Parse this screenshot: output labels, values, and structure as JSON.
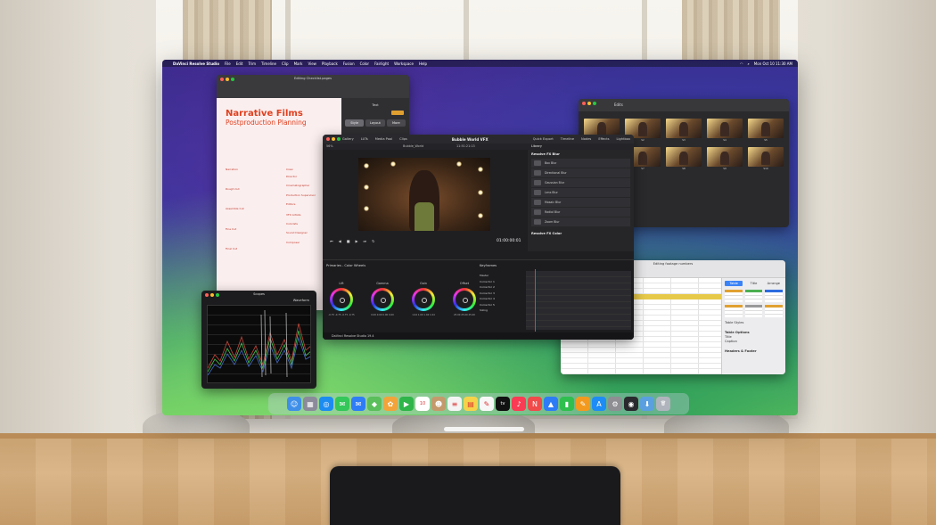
{
  "menubar": {
    "items": [
      "DaVinci Resolve Studio",
      "File",
      "Edit",
      "Trim",
      "Timeline",
      "Clip",
      "Mark",
      "View",
      "Playback",
      "Fusion",
      "Color",
      "Fairlight",
      "Workspace",
      "Help"
    ],
    "clock": "Mon Oct 10 11:30 AM"
  },
  "pages": {
    "window_title": "Editing Checklist.pages",
    "doc_title": "Narrative Films",
    "doc_subtitle": "Postproduction Planning",
    "left_col": [
      "Narration",
      "Rough Cut",
      "Assemble Cut",
      "Fine Cut",
      "Final Cut"
    ],
    "right_col": [
      "Crew",
      "Director",
      "Cinematographer",
      "Production Supervisor",
      "Editors",
      "VFX Artists",
      "Colorists",
      "Sound Designer",
      "Composer"
    ],
    "panel_label": "Text",
    "seg": [
      "Style",
      "Layout",
      "More"
    ]
  },
  "finder": {
    "title": "Edits",
    "files": [
      "S1",
      "S2",
      "S3",
      "S4",
      "S5",
      "S6",
      "S7",
      "S8",
      "S9",
      "S10"
    ]
  },
  "resolve": {
    "title": "Bubble World VFX",
    "project": "Bubble_World",
    "zoom": "56%",
    "timecode_top": "11:51:21:13",
    "timecode": "01:00:00:01",
    "tabs": [
      "Gallery",
      "LUTs",
      "Media Pool",
      "Clips"
    ],
    "right_tabs": [
      "Quick Export",
      "Timeline",
      "Nodes",
      "Effects",
      "Lightbox"
    ],
    "library_label": "Library",
    "library_group": "Resolve FX Blur",
    "effects": [
      "Box Blur",
      "Directional Blur",
      "Gaussian Blur",
      "Lens Blur",
      "Mosaic Blur",
      "Radial Blur",
      "Zoom Blur"
    ],
    "library_group2": "Resolve FX Color",
    "primaries_label": "Primaries - Color Wheels",
    "keyframes_label": "Keyframes",
    "wheels": [
      {
        "name": "Lift",
        "vals": "-0.75 -0.75 -0.75 -0.75"
      },
      {
        "name": "Gamma",
        "vals": "0.00 0.00 0.00 0.00"
      },
      {
        "name": "Gain",
        "vals": "1.04 1.00 1.04 1.04"
      },
      {
        "name": "Offset",
        "vals": "25.00 25.00 25.00"
      }
    ],
    "kf_items": [
      "Master",
      "Corrector 1",
      "Corrector 2",
      "Corrector 3",
      "Corrector 4",
      "Corrector 5",
      "Sizing"
    ],
    "app_name": "DaVinci Resolve Studio 19.4"
  },
  "numbers": {
    "title": "Editing footage numbers",
    "side_tabs": [
      "Table",
      "Title",
      "Arrange"
    ],
    "table_styles": "Table Styles",
    "table_options": "Table Options",
    "opt1": "Title",
    "opt2": "Caption",
    "headers_footer": "Headers & Footer"
  },
  "scopes": {
    "title": "Scopes",
    "mode": "Waveform"
  },
  "dock": [
    {
      "icon": "finder-icon",
      "color": "#3f8fe8",
      "glyph": "☺"
    },
    {
      "icon": "launchpad-icon",
      "color": "#8a8a9a",
      "glyph": "▦"
    },
    {
      "icon": "safari-icon",
      "color": "#1d8cf0",
      "glyph": "◎"
    },
    {
      "icon": "messages-icon",
      "color": "#34c759",
      "glyph": "✉"
    },
    {
      "icon": "mail-icon",
      "color": "#2f7df6",
      "glyph": "✉"
    },
    {
      "icon": "maps-icon",
      "color": "#5bbf5b",
      "glyph": "◆"
    },
    {
      "icon": "photos-icon",
      "color": "#f2a43a",
      "glyph": "✿"
    },
    {
      "icon": "facetime-icon",
      "color": "#2fb54a",
      "glyph": "▶"
    },
    {
      "icon": "calendar-icon",
      "color": "#ffffff",
      "glyph": "10"
    },
    {
      "icon": "contacts-icon",
      "color": "#c49a6c",
      "glyph": "☻"
    },
    {
      "icon": "reminders-icon",
      "color": "#f4f4f4",
      "glyph": "≡"
    },
    {
      "icon": "notes-icon",
      "color": "#f6d24a",
      "glyph": "▤"
    },
    {
      "icon": "freeform-icon",
      "color": "#f7f7f7",
      "glyph": "✎"
    },
    {
      "icon": "tv-icon",
      "color": "#111111",
      "glyph": "tv"
    },
    {
      "icon": "music-icon",
      "color": "#fb3b54",
      "glyph": "♪"
    },
    {
      "icon": "news-icon",
      "color": "#f04a4a",
      "glyph": "N"
    },
    {
      "icon": "keynote-icon",
      "color": "#2d7cf6",
      "glyph": "▲"
    },
    {
      "icon": "numbers-icon",
      "color": "#2fbf4f",
      "glyph": "▮"
    },
    {
      "icon": "pages-icon",
      "color": "#f39a1e",
      "glyph": "✎"
    },
    {
      "icon": "app-store-icon",
      "color": "#1e8cf5",
      "glyph": "A"
    },
    {
      "icon": "settings-icon",
      "color": "#8e8e93",
      "glyph": "⚙"
    },
    {
      "icon": "resolve-icon",
      "color": "#2a2a2e",
      "glyph": "◉"
    },
    {
      "icon": "downloads-icon",
      "color": "#5aa0e0",
      "glyph": "⬇"
    },
    {
      "icon": "trash-icon",
      "color": "#b0b4bc",
      "glyph": "🗑"
    }
  ]
}
